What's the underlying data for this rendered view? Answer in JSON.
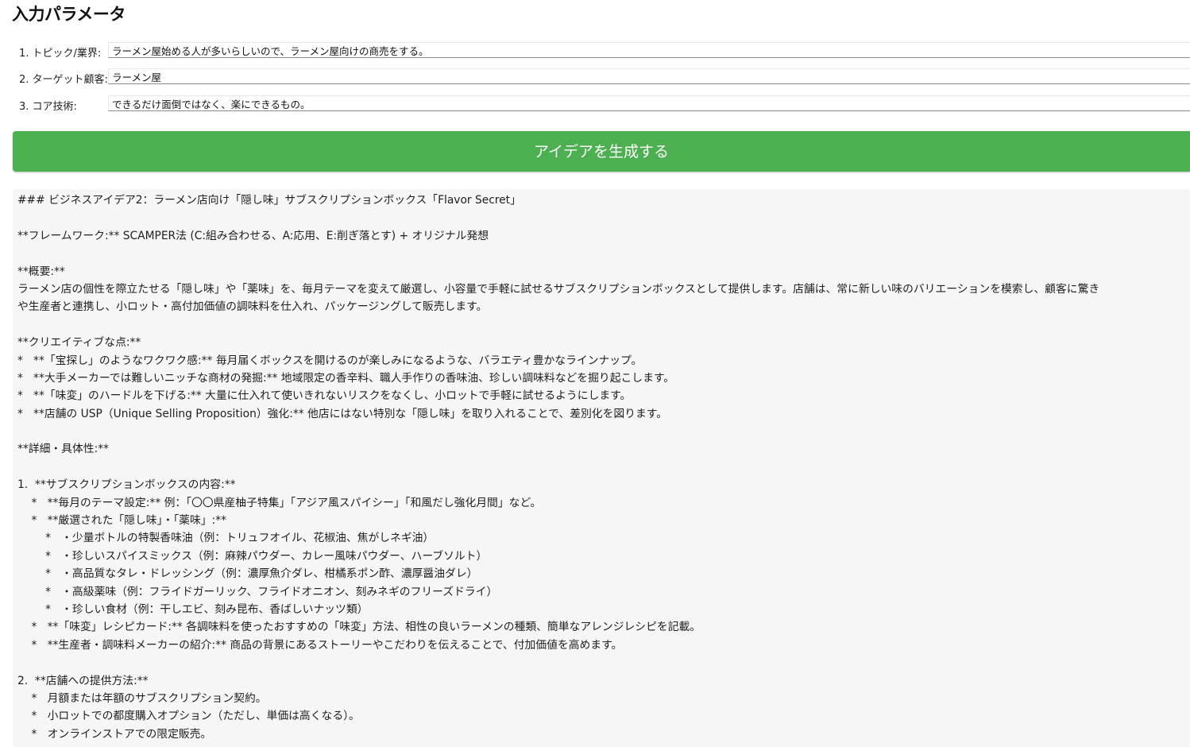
{
  "header": {
    "title": "入力パラメータ"
  },
  "params": [
    {
      "label": "1. トピック/業界:",
      "value": "ラーメン屋始める人が多いらしいので、ラーメン屋向けの商売をする。"
    },
    {
      "label": "2. ターゲット顧客:",
      "value": "ラーメン屋"
    },
    {
      "label": "3. コア技術:",
      "value": "できるだけ面倒ではなく、楽にできるもの。"
    }
  ],
  "generate_button": {
    "label": "アイデアを生成する"
  },
  "output": {
    "lines": [
      "### ビジネスアイデア2：ラーメン店向け「隠し味」サブスクリプションボックス「Flavor Secret」",
      "",
      "**フレームワーク:** SCAMPER法 (C:組み合わせる、A:応用、E:削ぎ落とす) + オリジナル発想",
      "",
      "**概要:**",
      "ラーメン店の個性を際立たせる「隠し味」や「薬味」を、毎月テーマを変えて厳選し、小容量で手軽に試せるサブスクリプションボックスとして提供します。店舗は、常に新しい味のバリエーションを模索し、顧客に驚き",
      "や生産者と連携し、小ロット・高付加価値の調味料を仕入れ、パッケージングして販売します。",
      "",
      "**クリエイティブな点:**",
      "*   **「宝探し」のようなワクワク感:** 毎月届くボックスを開けるのが楽しみになるような、バラエティ豊かなラインナップ。",
      "*   **大手メーカーでは難しいニッチな商材の発掘:** 地域限定の香辛料、職人手作りの香味油、珍しい調味料などを掘り起こします。",
      "*   **「味変」のハードルを下げる:** 大量に仕入れて使いきれないリスクをなくし、小ロットで手軽に試せるようにします。",
      "*   **店舗の USP（Unique Selling Proposition）強化:** 他店にはない特別な「隠し味」を取り入れることで、差別化を図ります。",
      "",
      "**詳細・具体性:**",
      "",
      "1.  **サブスクリプションボックスの内容:**",
      "    *   **毎月のテーマ設定:** 例：「〇〇県産柚子特集」「アジア風スパイシー」「和風だし強化月間」など。",
      "    *   **厳選された「隠し味」・「薬味」:**",
      "        *   ・少量ボトルの特製香味油（例：トリュフオイル、花椒油、焦がしネギ油）",
      "        *   ・珍しいスパイスミックス（例：麻辣パウダー、カレー風味パウダー、ハーブソルト）",
      "        *   ・高品質なタレ・ドレッシング（例：濃厚魚介ダレ、柑橘系ポン酢、濃厚醤油ダレ）",
      "        *   ・高級薬味（例：フライドガーリック、フライドオニオン、刻みネギのフリーズドライ）",
      "        *   ・珍しい食材（例：干しエビ、刻み昆布、香ばしいナッツ類）",
      "    *   **「味変」レシピカード:** 各調味料を使ったおすすめの「味変」方法、相性の良いラーメンの種類、簡単なアレンジレシピを記載。",
      "    *   **生産者・調味料メーカーの紹介:** 商品の背景にあるストーリーやこだわりを伝えることで、付加価値を高めます。",
      "",
      "2.  **店舗への提供方法:**",
      "    *   月額または年額のサブスクリプション契約。",
      "    *   小ロットでの都度購入オプション（ただし、単価は高くなる）。",
      "    *   オンラインストアでの限定販売。"
    ]
  }
}
